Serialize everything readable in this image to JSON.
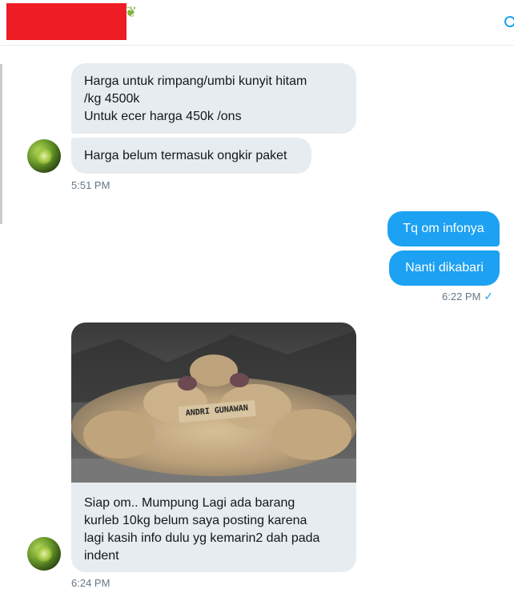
{
  "header": {
    "redacted_color": "#ee1c24",
    "decoration_icon": "leaf-icon",
    "info_icon": "info-icon"
  },
  "messages": [
    {
      "direction": "in",
      "text": "Harga untuk rimpang/umbi kunyit hitam\n/kg 4500k\nUntuk ecer harga 450k /ons"
    },
    {
      "direction": "in",
      "text": "Harga belum termasuk ongkir paket"
    },
    {
      "direction": "out",
      "text": "Tq om infonya"
    },
    {
      "direction": "out",
      "text": "Nanti dikabari"
    },
    {
      "direction": "in",
      "media_label": "ANDRI GUNAWAN",
      "text": "Siap om.. Mumpung Lagi ada barang\nkurleb 10kg belum saya posting karena\nlagi kasih info dulu yg kemarin2 dah pada\nindent"
    }
  ],
  "timestamps": {
    "group1": "5:51 PM",
    "group2": "6:22 PM",
    "group3": "6:24 PM"
  },
  "colors": {
    "incoming_bubble": "#e6ecf0",
    "outgoing_bubble": "#1da1f2",
    "timestamp": "#657786"
  }
}
